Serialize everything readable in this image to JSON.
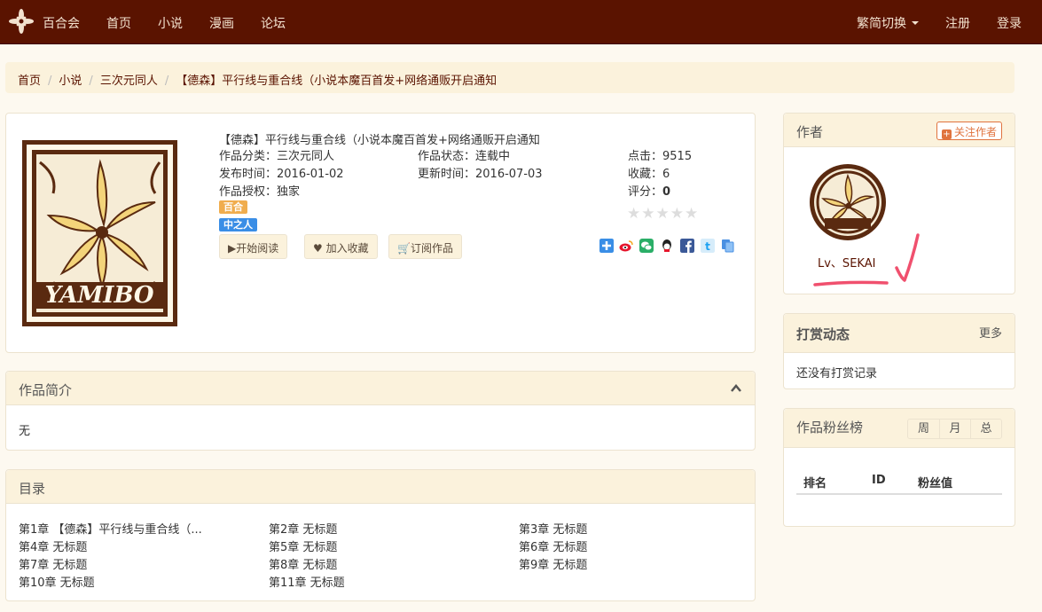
{
  "nav": {
    "brand": "百合会",
    "links": [
      "首页",
      "小说",
      "漫画",
      "论坛"
    ],
    "lang_switch": "繁简切换",
    "register": "注册",
    "login": "登录"
  },
  "breadcrumb": {
    "items": [
      "首页",
      "小说",
      "三次元同人"
    ],
    "current": "【德森】平行线与重合线（小说本魔百首发+网络通贩开启通知"
  },
  "book": {
    "cover_text": "YAMIBO",
    "title": "【德森】平行线与重合线（小说本魔百首发+网络通贩开启通知",
    "category": "作品分类：三次元同人",
    "publish": "发布时间：2016-01-02",
    "license": "作品授权：独家",
    "status": "作品状态：连载中",
    "update": "更新时间：2016-07-03",
    "clicks_label": "点击：",
    "clicks": "9515",
    "favs_label": "收藏：",
    "favs": "6",
    "score_label": "评分：",
    "score": "0",
    "rating_stars": 0,
    "tags": [
      {
        "label": "百合",
        "color": "#f0ad4e"
      },
      {
        "label": "中之人",
        "color": "#3a8ee6"
      }
    ],
    "buttons": {
      "read": "开始阅读",
      "fav": "加入收藏",
      "subscribe": "订阅作品"
    },
    "share_icons": [
      "plus-share-icon",
      "weibo-icon",
      "wechat-icon",
      "qq-icon",
      "facebook-icon",
      "twitter-icon",
      "copy-link-icon"
    ]
  },
  "intro": {
    "title": "作品简介",
    "text": "无"
  },
  "toc": {
    "title": "目录",
    "chapters": [
      "第1章 【德森】平行线与重合线（...",
      "第2章 无标题",
      "第3章 无标题",
      "第4章 无标题",
      "第5章 无标题",
      "第6章 无标题",
      "第7章 无标题",
      "第8章 无标题",
      "第9章 无标题",
      "第10章 无标题",
      "第11章 无标题"
    ]
  },
  "author": {
    "title": "作者",
    "follow": "关注作者",
    "name": "Lv、SEKAI"
  },
  "rewards": {
    "title": "打赏动态",
    "more": "更多",
    "empty": "还没有打赏记录"
  },
  "fans": {
    "title": "作品粉丝榜",
    "tabs": [
      "周",
      "月",
      "总"
    ],
    "columns": [
      "排名",
      "ID",
      "粉丝值"
    ]
  },
  "colors": {
    "navbar": "#5a1300",
    "panel_header": "#fbf2dc",
    "background": "#fdf9f0",
    "accent": "#e0733e",
    "annotation": "#f0506e"
  }
}
